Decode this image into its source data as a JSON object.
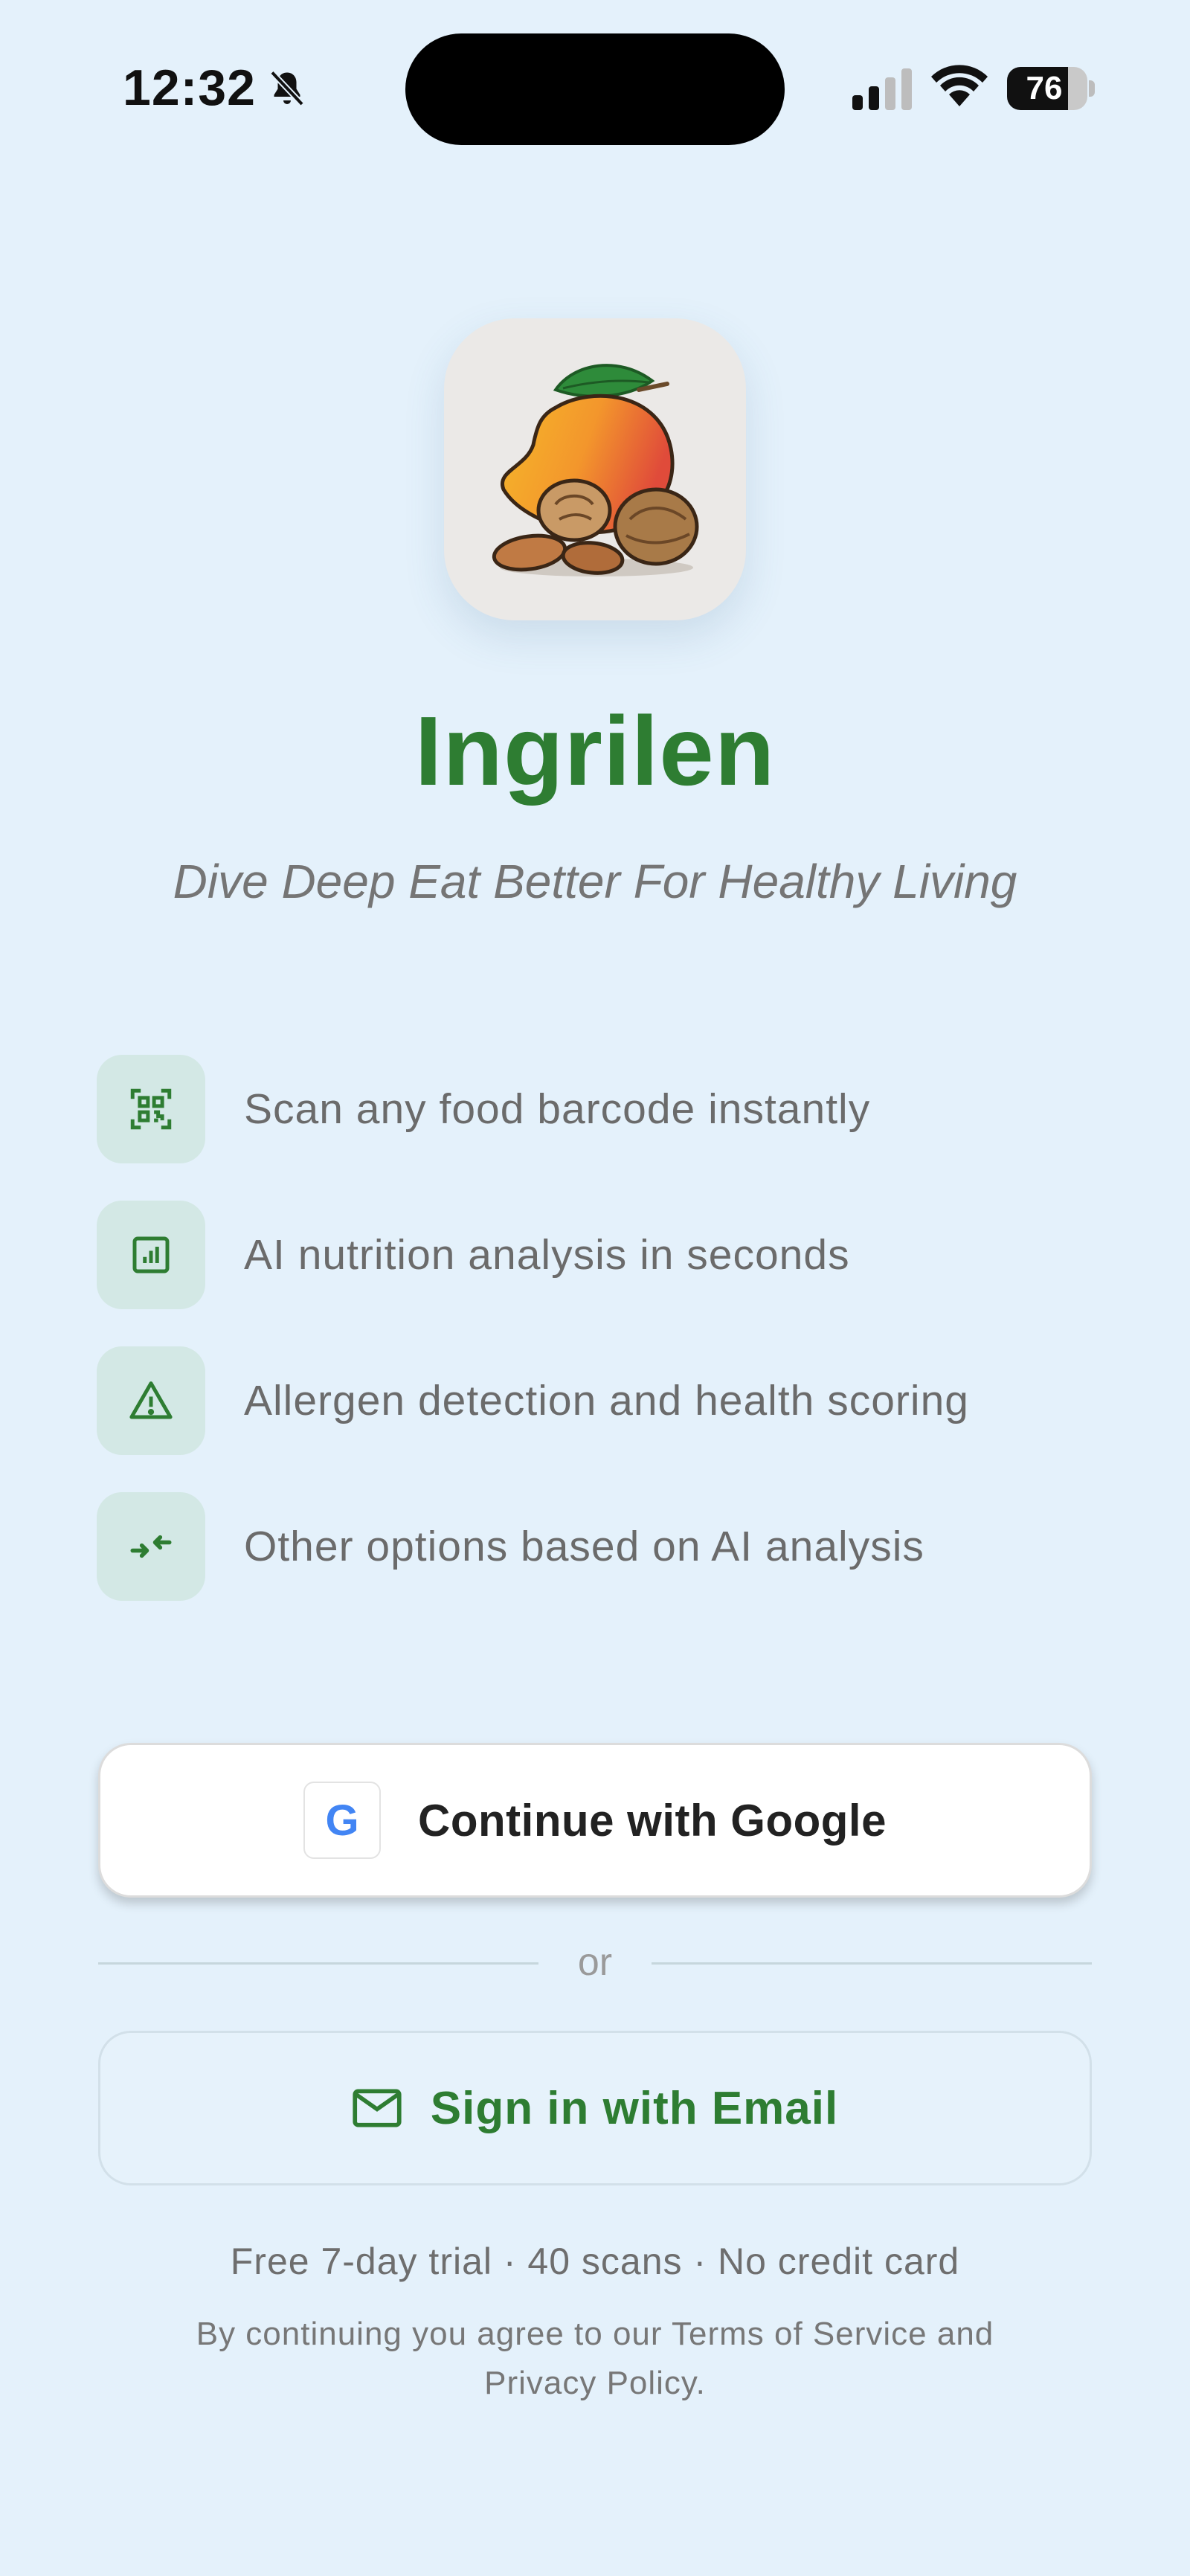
{
  "status_bar": {
    "time": "12:32",
    "battery": "76",
    "icons": [
      "bell-slash-icon",
      "cellular-signal-icon",
      "wifi-icon",
      "battery-icon"
    ]
  },
  "hero": {
    "app_icon": "mango-nuts-logo",
    "app_name": "Ingrilen",
    "tagline": "Dive Deep Eat Better For Healthy Living"
  },
  "features": [
    {
      "icon": "barcode-scan-icon",
      "text": "Scan any food barcode instantly"
    },
    {
      "icon": "chart-icon",
      "text": "AI nutrition analysis in seconds"
    },
    {
      "icon": "warning-icon",
      "text": "Allergen detection and health scoring"
    },
    {
      "icon": "compare-arrows-icon",
      "text": "Other options based on AI analysis"
    }
  ],
  "auth": {
    "google_logo": "G",
    "google_label": "Continue with Google",
    "divider": "or",
    "email_label": "Sign in with Email"
  },
  "footer": {
    "trial": "Free 7-day trial · 40 scans · No credit card",
    "legal": "By continuing you agree to our Terms of Service and Privacy Policy."
  },
  "colors": {
    "background": "#e4f1fb",
    "brand_green": "#2e7d32",
    "feature_tile": "#d3e8e5",
    "google_blue": "#4285f4"
  }
}
